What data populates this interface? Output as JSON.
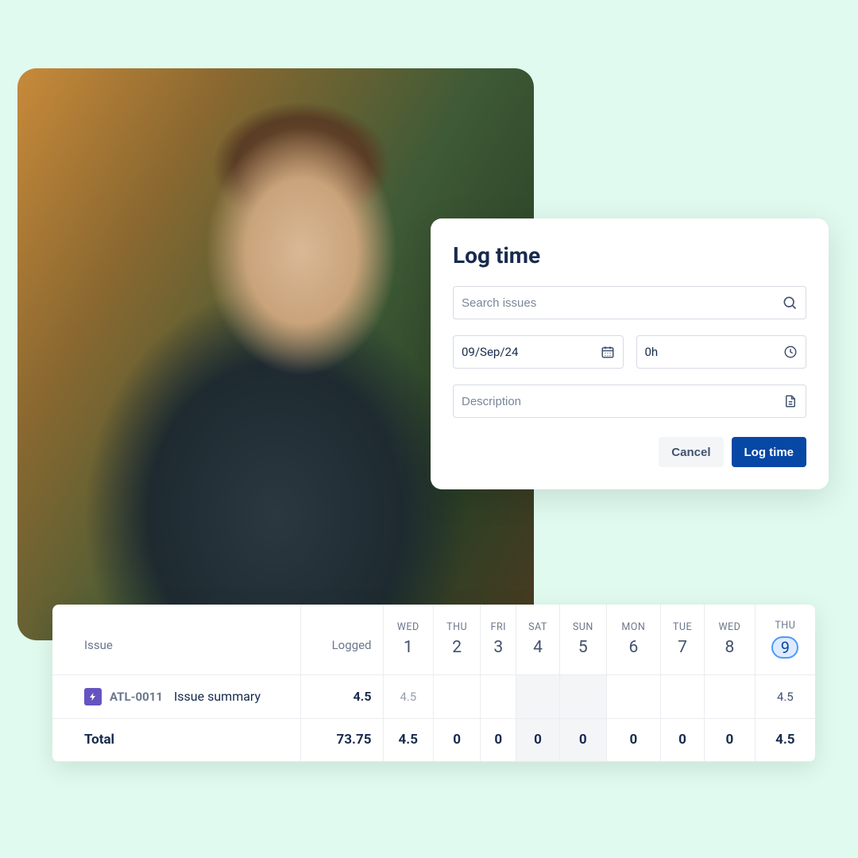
{
  "modal": {
    "title": "Log time",
    "search_placeholder": "Search issues",
    "date_value": "09/Sep/24",
    "duration_value": "0h",
    "description_placeholder": "Description",
    "cancel_label": "Cancel",
    "submit_label": "Log time"
  },
  "sheet": {
    "headers": {
      "issue": "Issue",
      "logged": "Logged"
    },
    "days": [
      {
        "dow": "WED",
        "num": "1",
        "weekend": false,
        "today": false
      },
      {
        "dow": "THU",
        "num": "2",
        "weekend": false,
        "today": false
      },
      {
        "dow": "FRI",
        "num": "3",
        "weekend": false,
        "today": false
      },
      {
        "dow": "SAT",
        "num": "4",
        "weekend": true,
        "today": false
      },
      {
        "dow": "SUN",
        "num": "5",
        "weekend": true,
        "today": false
      },
      {
        "dow": "MON",
        "num": "6",
        "weekend": false,
        "today": false
      },
      {
        "dow": "TUE",
        "num": "7",
        "weekend": false,
        "today": false
      },
      {
        "dow": "WED",
        "num": "8",
        "weekend": false,
        "today": false
      },
      {
        "dow": "THU",
        "num": "9",
        "weekend": false,
        "today": true
      }
    ],
    "row": {
      "key": "ATL-0011",
      "summary": "Issue summary",
      "logged": "4.5",
      "cells": [
        "4.5",
        "",
        "",
        "",
        "",
        "",
        "",
        "",
        "4.5"
      ]
    },
    "total": {
      "label": "Total",
      "logged": "73.75",
      "cells": [
        "4.5",
        "0",
        "0",
        "0",
        "0",
        "0",
        "0",
        "0",
        "4.5"
      ]
    }
  }
}
